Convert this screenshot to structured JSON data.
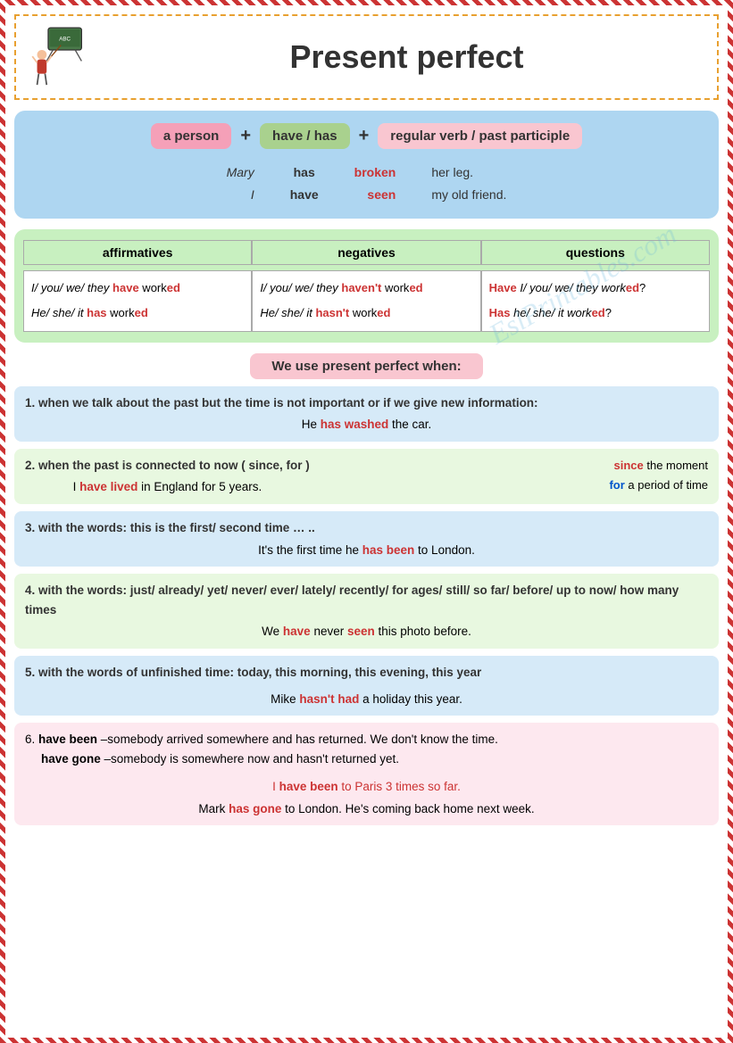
{
  "header": {
    "title": "Present perfect",
    "watermark": "EslPrintables.com"
  },
  "formula": {
    "box1": "a person",
    "plus1": "+",
    "box2": "have / has",
    "plus2": "+",
    "box3": "regular verb / past participle",
    "examples": [
      {
        "person": "Mary",
        "aux": "has",
        "verb": "broken",
        "rest": "her leg."
      },
      {
        "person": "I",
        "aux": "have",
        "verb": "seen",
        "rest": "my old friend."
      }
    ]
  },
  "conjugation": {
    "headers": [
      "affirmatives",
      "negatives",
      "questions"
    ],
    "rows": [
      {
        "affirmative": "I/ you/ we/ they have worked",
        "affirmative_parts": {
          "prefix": "I/ you/ we/ they ",
          "aux": "have",
          "verb": " work",
          "ending": "ed"
        },
        "negative": "I/ you/ we/ they haven't worked",
        "negative_parts": {
          "prefix": "I/ you/ we/ they ",
          "aux": "haven't",
          "verb": " work",
          "ending": "ed"
        },
        "question": "Have I/ you/ we/ they worked?",
        "question_parts": {
          "aux": "Have",
          "middle": " I/ you/ we/ they work",
          "ending": "ed?"
        }
      },
      {
        "affirmative": "He/ she/ it has worked",
        "affirmative_parts": {
          "prefix": "He/ she/ it ",
          "aux": "has",
          "verb": " work",
          "ending": "ed"
        },
        "negative": "He/ she/ it hasn't worked",
        "negative_parts": {
          "prefix": "He/ she/ it ",
          "aux": "hasn't",
          "verb": " work",
          "ending": "ed"
        },
        "question": "Has he/ she/ it worked?",
        "question_parts": {
          "aux": "Has",
          "middle": " he/ she/ it work",
          "ending": "ed?"
        }
      }
    ]
  },
  "usage_label": "We use present perfect when:",
  "usage_items": [
    {
      "number": "1.",
      "title": "when we talk about the past but the time is not important or if we give new information:",
      "example": "He has washed the car.",
      "example_parts": {
        "prefix": "He ",
        "aux": "has washed",
        "rest": " the car."
      },
      "color": "blue"
    },
    {
      "number": "2.",
      "title": "when the past is connected to now  ( since, for )",
      "example": "I have lived in England for 5 years.",
      "example_parts": {
        "prefix": "I ",
        "aux": "have lived",
        "rest": " in England for 5 years."
      },
      "since_note": "since the moment",
      "for_note": "for a period of time",
      "color": "green"
    },
    {
      "number": "3.",
      "title": "with the words: this is the first/ second time … ..",
      "example": "It's the first time he has been to London.",
      "example_parts": {
        "prefix": "It's the first time he ",
        "aux": "has been",
        "rest": " to London."
      },
      "color": "blue"
    },
    {
      "number": "4.",
      "title": "with the words: just/ already/ yet/ never/ ever/ lately/ recently/ for ages/ still/ so far/ before/ up to now/ how many times",
      "example": "We have never seen this photo before.",
      "example_parts": {
        "prefix": "We ",
        "aux1": "have",
        "middle": " never ",
        "aux2": "seen",
        "rest": " this photo before."
      },
      "color": "green"
    },
    {
      "number": "5.",
      "title": "with the words of unfinished time: today, this morning, this evening, this year",
      "example": "Mike hasn't had a holiday this year.",
      "example_parts": {
        "prefix": "Mike ",
        "aux": "hasn't had",
        "rest": " a holiday this year."
      },
      "color": "blue"
    },
    {
      "number": "6.",
      "title_line1": "have been –somebody arrived somewhere and has returned. We don't know the time.",
      "title_line2": "have gone –somebody is somewhere now and hasn't returned yet.",
      "example1": "I have been to Paris 3 times so far.",
      "example1_parts": {
        "prefix": "I ",
        "aux": "have been",
        "rest": " to Paris 3 times so far."
      },
      "example2": "Mark has gone to London. He's coming back home next week.",
      "example2_parts": {
        "prefix": "Mark ",
        "aux": "has gone",
        "rest": " to London. He's coming back home next week."
      },
      "color": "pink"
    }
  ]
}
